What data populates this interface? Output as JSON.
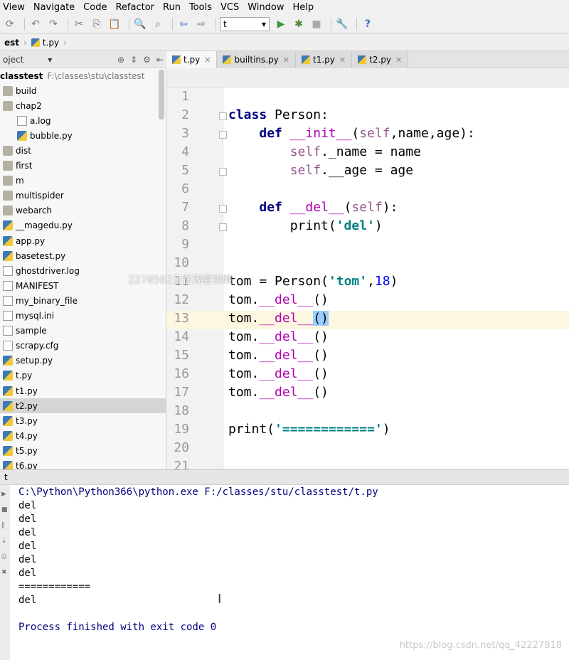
{
  "menu": [
    "View",
    "Navigate",
    "Code",
    "Refactor",
    "Run",
    "Tools",
    "VCS",
    "Window",
    "Help"
  ],
  "toolbar": {
    "run_config": "t"
  },
  "breadcrumb": {
    "root": "est",
    "file": "t.py"
  },
  "project_panel": {
    "title": "oject"
  },
  "tree": {
    "root": {
      "name": "classtest",
      "path": "F:\\classes\\stu\\classtest"
    },
    "items": [
      {
        "name": "build",
        "type": "folder",
        "indent": 0
      },
      {
        "name": "chap2",
        "type": "folder",
        "indent": 0
      },
      {
        "name": "a.log",
        "type": "txt",
        "indent": 1
      },
      {
        "name": "bubble.py",
        "type": "py",
        "indent": 1
      },
      {
        "name": "dist",
        "type": "folder",
        "indent": 0
      },
      {
        "name": "first",
        "type": "folder",
        "indent": 0
      },
      {
        "name": "m",
        "type": "folder",
        "indent": 0
      },
      {
        "name": "multispider",
        "type": "folder",
        "indent": 0
      },
      {
        "name": "webarch",
        "type": "folder",
        "indent": 0
      },
      {
        "name": "__magedu.py",
        "type": "py",
        "indent": 0
      },
      {
        "name": "app.py",
        "type": "py",
        "indent": 0
      },
      {
        "name": "basetest.py",
        "type": "py",
        "indent": 0
      },
      {
        "name": "ghostdriver.log",
        "type": "txt",
        "indent": 0
      },
      {
        "name": "MANIFEST",
        "type": "txt",
        "indent": 0
      },
      {
        "name": "my_binary_file",
        "type": "txt",
        "indent": 0
      },
      {
        "name": "mysql.ini",
        "type": "txt",
        "indent": 0
      },
      {
        "name": "sample",
        "type": "txt",
        "indent": 0
      },
      {
        "name": "scrapy.cfg",
        "type": "txt",
        "indent": 0
      },
      {
        "name": "setup.py",
        "type": "py",
        "indent": 0
      },
      {
        "name": "t.py",
        "type": "py",
        "indent": 0
      },
      {
        "name": "t1.py",
        "type": "py",
        "indent": 0
      },
      {
        "name": "t2.py",
        "type": "py",
        "indent": 0,
        "selected": true
      },
      {
        "name": "t3.py",
        "type": "py",
        "indent": 0
      },
      {
        "name": "t4.py",
        "type": "py",
        "indent": 0
      },
      {
        "name": "t5.py",
        "type": "py",
        "indent": 0
      },
      {
        "name": "t6.py",
        "type": "py",
        "indent": 0
      }
    ]
  },
  "tabs": [
    {
      "label": "t.py",
      "active": true
    },
    {
      "label": "builtins.py"
    },
    {
      "label": "t1.py"
    },
    {
      "label": "t2.py"
    }
  ],
  "editor": {
    "line_numbers": [
      "1",
      "2",
      "3",
      "4",
      "5",
      "6",
      "7",
      "8",
      "9",
      "10",
      "11",
      "12",
      "13",
      "14",
      "15",
      "16",
      "17",
      "18",
      "19",
      "20",
      "21"
    ]
  },
  "overlay_text": "2278562正在观看视频",
  "run_panel": {
    "tab": "t",
    "command": "C:\\Python\\Python366\\python.exe F:/classes/stu/classtest/t.py",
    "output": [
      "del",
      "del",
      "del",
      "del",
      "del",
      "del",
      "============",
      "del"
    ],
    "exit_message": "Process finished with exit code 0"
  },
  "watermark": "https://blog.csdn.net/qq_42227818"
}
